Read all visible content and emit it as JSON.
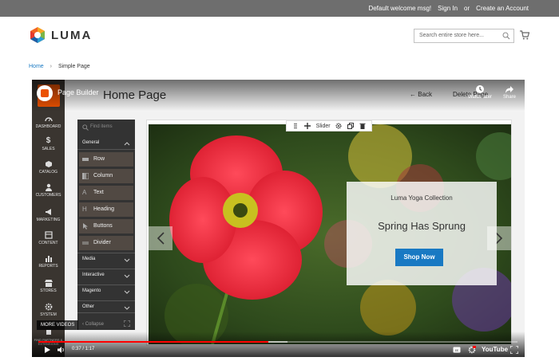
{
  "store": {
    "welcome": "Default welcome msg!",
    "sign_in": "Sign In",
    "or": "or",
    "create_account": "Create an Account",
    "logo_text": "LUMA",
    "search_placeholder": "Search entire store here...",
    "breadcrumbs": [
      "Home",
      "Simple Page"
    ]
  },
  "admin": {
    "page_title": "Home Page",
    "back_label": "Back",
    "delete_label": "Delete Page",
    "nav": [
      {
        "label": "DASHBOARD",
        "icon": "dashboard-icon"
      },
      {
        "label": "SALES",
        "icon": "dollar-icon"
      },
      {
        "label": "CATALOG",
        "icon": "cube-icon"
      },
      {
        "label": "CUSTOMERS",
        "icon": "person-icon"
      },
      {
        "label": "MARKETING",
        "icon": "megaphone-icon"
      },
      {
        "label": "CONTENT",
        "icon": "layout-icon"
      },
      {
        "label": "REPORTS",
        "icon": "bar-chart-icon"
      },
      {
        "label": "STORES",
        "icon": "store-icon"
      },
      {
        "label": "SYSTEM",
        "icon": "gear-icon"
      },
      {
        "label": "FIND PARTNERS & EXTENSIONS",
        "icon": "puzzle-icon"
      }
    ]
  },
  "panel": {
    "find_placeholder": "Find items",
    "group_general": "General",
    "items": [
      {
        "label": "Row",
        "icon": "row-icon"
      },
      {
        "label": "Column",
        "icon": "column-icon"
      },
      {
        "label": "Text",
        "icon": "text-icon"
      },
      {
        "label": "Heading",
        "icon": "heading-icon"
      },
      {
        "label": "Buttons",
        "icon": "cursor-icon"
      },
      {
        "label": "Divider",
        "icon": "divider-icon"
      }
    ],
    "groups": [
      "Media",
      "Interactive",
      "Magento",
      "Other"
    ],
    "collapse_label": "Collapse"
  },
  "stage": {
    "toolbar_label": "Slider",
    "banner_eyebrow": "Luma Yoga Collection",
    "banner_headline": "Spring Has Sprung",
    "banner_cta": "Shop Now"
  },
  "video": {
    "title": "Page Builder",
    "watch_later": "Watch later",
    "share": "Share",
    "more_videos": "MORE VIDEOS",
    "time": "0:37 / 1:17",
    "progress": 0.48,
    "buffered": 0.52,
    "wordmark": "YouTube"
  },
  "colors": {
    "accent_blue": "#1979c3",
    "magento_orange": "#eb5202",
    "admin_dark": "#3a3530",
    "progress_red": "#ff0000"
  }
}
